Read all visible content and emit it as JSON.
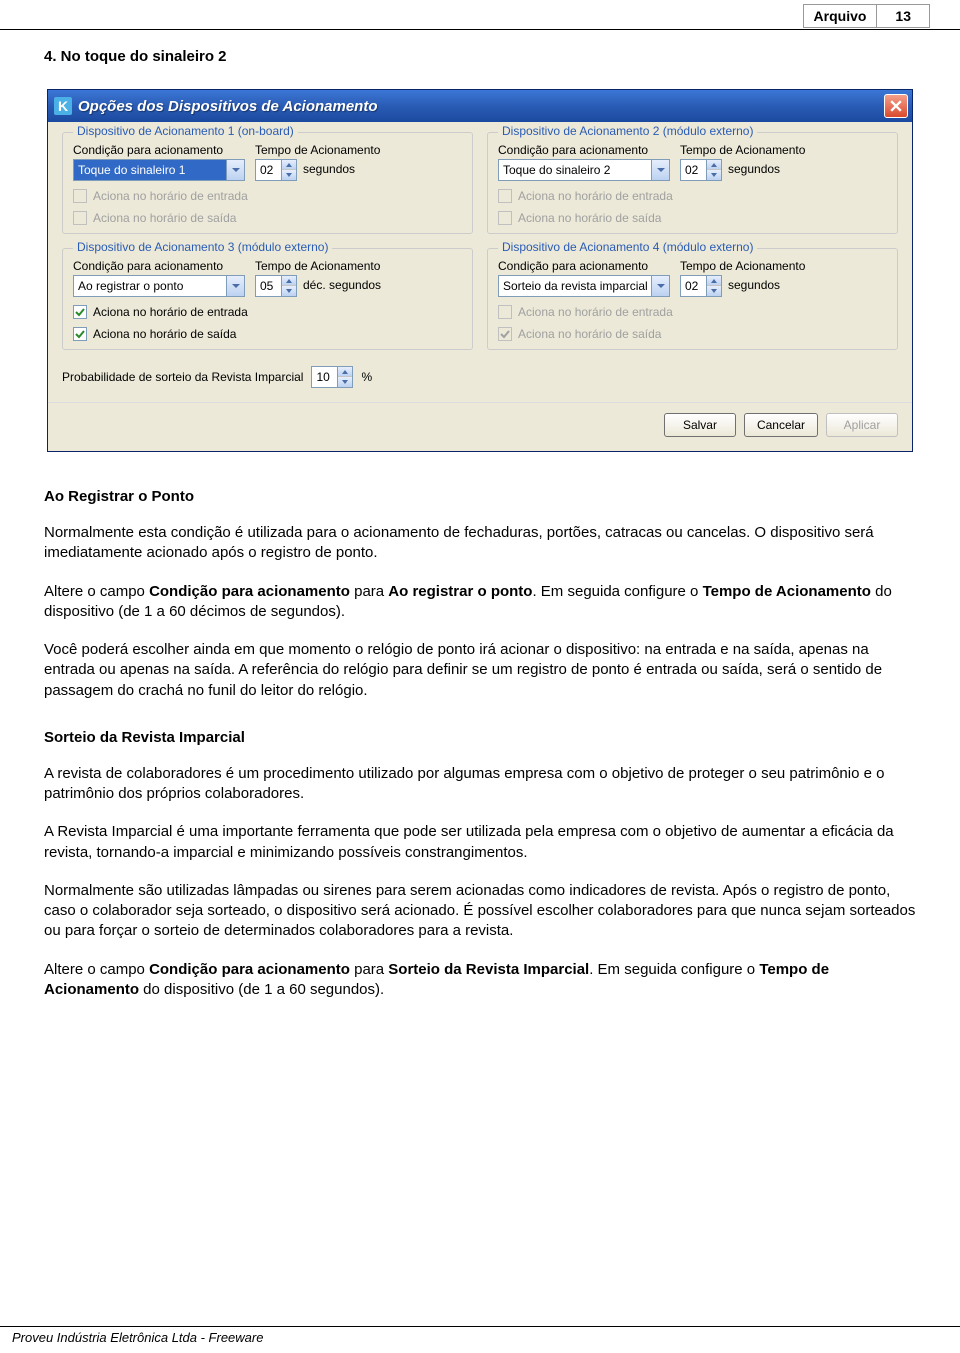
{
  "header": {
    "label": "Arquivo",
    "page": "13"
  },
  "section_title": "4. No toque do sinaleiro 2",
  "dialog": {
    "title": "Opções dos Dispositivos de Acionamento",
    "icon_letter": "K",
    "groups": [
      {
        "legend": "Dispositivo de Acionamento 1 (on-board)",
        "cond_label": "Condição para acionamento",
        "tempo_label": "Tempo de Acionamento",
        "cond_value": "Toque do sinaleiro 1",
        "tempo_value": "02",
        "unit": "segundos",
        "selected": true,
        "chk1": "Aciona no horário de entrada",
        "chk2": "Aciona no horário de saída",
        "chk1_checked": false,
        "chk2_checked": false,
        "chk_disabled": true
      },
      {
        "legend": "Dispositivo de Acionamento 2 (módulo externo)",
        "cond_label": "Condição para acionamento",
        "tempo_label": "Tempo de Acionamento",
        "cond_value": "Toque do sinaleiro 2",
        "tempo_value": "02",
        "unit": "segundos",
        "selected": false,
        "chk1": "Aciona no horário de entrada",
        "chk2": "Aciona no horário de saída",
        "chk1_checked": false,
        "chk2_checked": false,
        "chk_disabled": true
      },
      {
        "legend": "Dispositivo de Acionamento 3 (módulo externo)",
        "cond_label": "Condição para acionamento",
        "tempo_label": "Tempo de Acionamento",
        "cond_value": "Ao registrar o ponto",
        "tempo_value": "05",
        "unit": "déc. segundos",
        "selected": false,
        "chk1": "Aciona no horário de entrada",
        "chk2": "Aciona no horário de saída",
        "chk1_checked": true,
        "chk2_checked": true,
        "chk_disabled": false
      },
      {
        "legend": "Dispositivo de Acionamento 4 (módulo externo)",
        "cond_label": "Condição para acionamento",
        "tempo_label": "Tempo de Acionamento",
        "cond_value": "Sorteio da revista imparcial",
        "tempo_value": "02",
        "unit": "segundos",
        "selected": false,
        "chk1": "Aciona no horário de entrada",
        "chk2": "Aciona no horário de saída",
        "chk1_checked": false,
        "chk2_checked": true,
        "chk_disabled": true
      }
    ],
    "prob_label": "Probabilidade de sorteio da Revista Imparcial",
    "prob_value": "10",
    "prob_unit": "%",
    "buttons": {
      "save": "Salvar",
      "cancel": "Cancelar",
      "apply": "Aplicar"
    }
  },
  "body": {
    "h1": "Ao Registrar o Ponto",
    "p1": "Normalmente esta condição é utilizada para o acionamento de fechaduras, portões, catracas ou cancelas. O dispositivo será imediatamente acionado após o registro de ponto.",
    "p2a": "Altere o campo ",
    "p2b": "Condição para acionamento",
    "p2c": " para ",
    "p2d": "Ao registrar o ponto",
    "p2e": ". Em seguida configure o ",
    "p2f": "Tempo de Acionamento",
    "p2g": " do dispositivo (de 1 a 60 décimos de segundos).",
    "p3": "Você poderá escolher ainda em que momento o relógio de ponto irá acionar o dispositivo: na entrada e na saída, apenas na entrada ou apenas na saída. A referência do relógio para definir se um registro de ponto é entrada ou saída, será o sentido de passagem do crachá no funil do leitor do relógio.",
    "h2": "Sorteio da Revista Imparcial",
    "p4": "A revista de colaboradores é um procedimento utilizado por algumas empresa com o objetivo de proteger o seu patrimônio e o patrimônio dos próprios colaboradores.",
    "p5": "A Revista Imparcial é uma importante ferramenta que pode ser utilizada pela empresa com o objetivo de aumentar a eficácia da revista, tornando-a imparcial e minimizando possíveis constrangimentos.",
    "p6": "Normalmente são utilizadas lâmpadas ou sirenes para serem acionadas como indicadores de revista. Após o registro de ponto, caso o colaborador seja sorteado, o dispositivo será acionado. É possível escolher colaboradores para que nunca sejam sorteados ou para forçar o sorteio de determinados colaboradores para a revista.",
    "p7a": "Altere o campo ",
    "p7b": "Condição para acionamento",
    "p7c": " para ",
    "p7d": "Sorteio da Revista Imparcial",
    "p7e": ". Em seguida configure o ",
    "p7f": "Tempo de Acionamento",
    "p7g": " do dispositivo (de 1 a 60 segundos)."
  },
  "footer": "Proveu Indústria Eletrônica Ltda - Freeware"
}
